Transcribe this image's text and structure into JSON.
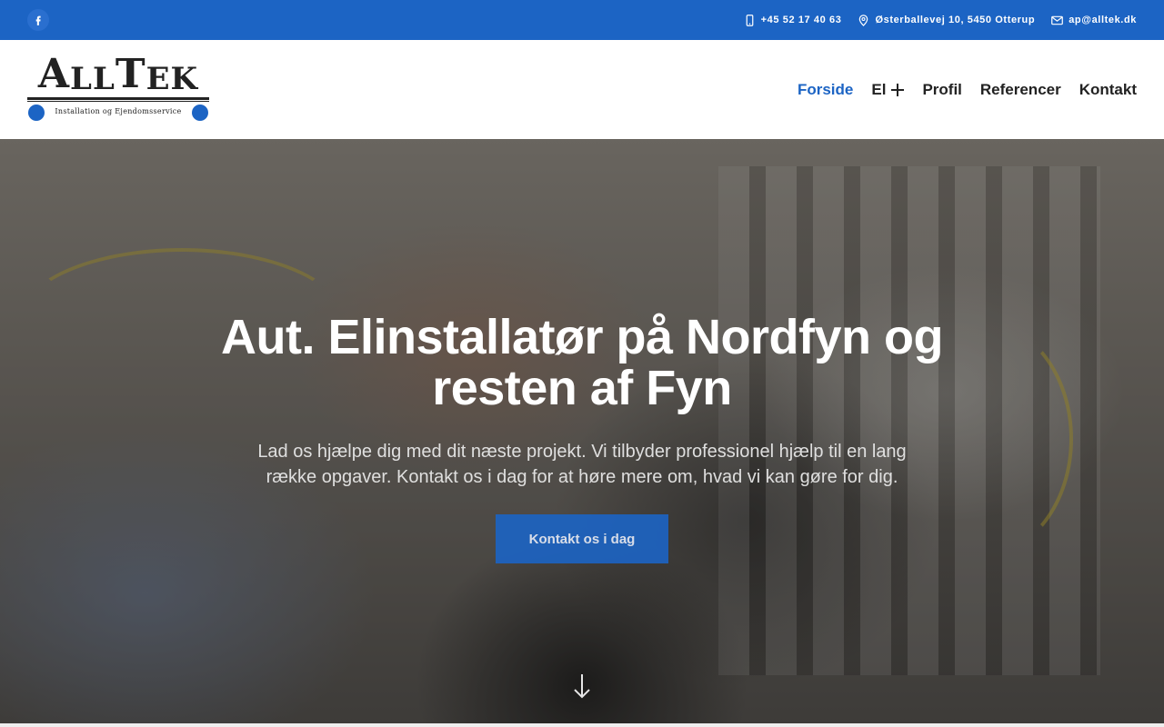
{
  "topbar": {
    "social": {
      "icon": "facebook-icon"
    },
    "phone": "+45 52 17 40 63",
    "address": "Østerballevej 10, 5450 Otterup",
    "email": "ap@alltek.dk"
  },
  "logo": {
    "first_big": "A",
    "first_small": "LL",
    "second_big": "T",
    "second_small": "EK",
    "tagline": "Installation og Ejendomsservice"
  },
  "nav": {
    "items": [
      {
        "label": "Forside",
        "active": true
      },
      {
        "label": "El",
        "has_submenu": true
      },
      {
        "label": "Profil"
      },
      {
        "label": "Referencer"
      },
      {
        "label": "Kontakt"
      }
    ]
  },
  "hero": {
    "title": "Aut. Elinstallatør på Nordfyn og resten af Fyn",
    "subtitle": "Lad os hjælpe dig med dit næste projekt. Vi tilbyder professionel hjælp til en lang række opgaver. Kontakt os i dag for at høre mere om, hvad vi kan gøre for dig.",
    "cta": "Kontakt os i dag"
  },
  "colors": {
    "brand_blue": "#1c64c4",
    "text_dark": "#222222"
  }
}
